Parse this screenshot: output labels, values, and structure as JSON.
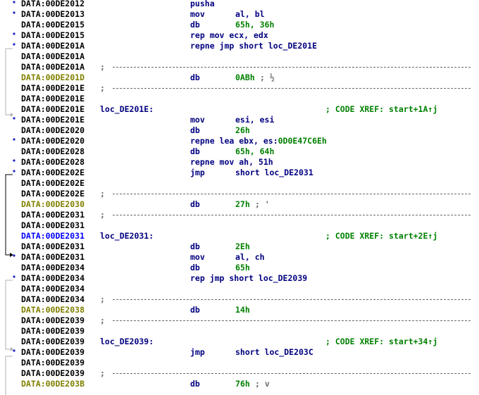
{
  "rows": [
    {
      "addr": "DATA:00DE2012",
      "ac": 0,
      "mn": "pusha",
      "op": "",
      "dot": true
    },
    {
      "addr": "DATA:00DE2013",
      "ac": 0,
      "mn": "mov",
      "op": "al, bl",
      "dot": true
    },
    {
      "addr": "DATA:00DE2015",
      "ac": 0,
      "mn": "db",
      "op": "65h, 36h",
      "opc": "n",
      "dot": false
    },
    {
      "addr": "DATA:00DE2015",
      "ac": 0,
      "mn": "rep mov ecx, edx",
      "op": "",
      "dot": true
    },
    {
      "addr": "DATA:00DE201A",
      "ac": 0,
      "mn": "repne jmp short loc_DE201E",
      "op": "",
      "dot": true
    },
    {
      "addr": "DATA:00DE201A",
      "ac": 0,
      "mn": "",
      "op": "",
      "dot": false
    },
    {
      "addr": "DATA:00DE201A",
      "ac": 0,
      "sep": true,
      "dot": false
    },
    {
      "addr": "DATA:00DE201D",
      "ac": 1,
      "mn": "db",
      "op": "0ABh",
      "opc": "n",
      "cmt": "; ½",
      "cmtc": "gr",
      "dot": false
    },
    {
      "addr": "DATA:00DE201E",
      "ac": 0,
      "sep": true,
      "dot": false
    },
    {
      "addr": "DATA:00DE201E",
      "ac": 0,
      "mn": "",
      "op": "",
      "dot": false
    },
    {
      "addr": "DATA:00DE201E",
      "ac": 0,
      "lbl": "loc_DE201E:",
      "xref": "; CODE XREF: start+1A↑j",
      "dot": false
    },
    {
      "addr": "DATA:00DE201E",
      "ac": 0,
      "mn": "mov",
      "op": "esi, esi",
      "dot": true
    },
    {
      "addr": "DATA:00DE2020",
      "ac": 0,
      "mn": "db",
      "op": "26h",
      "opc": "n",
      "dot": false
    },
    {
      "addr": "DATA:00DE2020",
      "ac": 0,
      "mn": "repne lea ebx, es:",
      "op": "",
      "tail": "0D0E47C6Eh",
      "dot": true
    },
    {
      "addr": "DATA:00DE2028",
      "ac": 0,
      "mn": "db",
      "op": "65h, 64h",
      "opc": "n",
      "dot": false
    },
    {
      "addr": "DATA:00DE2028",
      "ac": 0,
      "mn": "repne mov ah, 51h",
      "op": "",
      "dot": true
    },
    {
      "addr": "DATA:00DE202E",
      "ac": 0,
      "mn": "jmp",
      "op": "short loc_DE2031",
      "dot": true
    },
    {
      "addr": "DATA:00DE202E",
      "ac": 0,
      "mn": "",
      "op": "",
      "dot": false
    },
    {
      "addr": "DATA:00DE202E",
      "ac": 0,
      "sep": true,
      "dot": false
    },
    {
      "addr": "DATA:00DE2030",
      "ac": 1,
      "mn": "db",
      "op": "27h",
      "opc": "n",
      "cmt": "; '",
      "cmtc": "gr",
      "dot": false
    },
    {
      "addr": "DATA:00DE2031",
      "ac": 0,
      "sep": true,
      "dot": false
    },
    {
      "addr": "DATA:00DE2031",
      "ac": 0,
      "mn": "",
      "op": "",
      "dot": false
    },
    {
      "addr": "DATA:00DE2031",
      "ac": 2,
      "lbl": "loc_DE2031:",
      "xref": "; CODE XREF: start+2E↑j",
      "dot": false
    },
    {
      "addr": "DATA:00DE2031",
      "ac": 0,
      "mn": "db",
      "op": "2Eh",
      "opc": "n",
      "dot": false
    },
    {
      "addr": "DATA:00DE2031",
      "ac": 0,
      "mn": "mov",
      "op": "al, ch",
      "dot": true
    },
    {
      "addr": "DATA:00DE2034",
      "ac": 0,
      "mn": "db",
      "op": "65h",
      "opc": "n",
      "dot": false
    },
    {
      "addr": "DATA:00DE2034",
      "ac": 0,
      "mn": "rep jmp short loc_DE2039",
      "op": "",
      "dot": true
    },
    {
      "addr": "DATA:00DE2034",
      "ac": 0,
      "mn": "",
      "op": "",
      "dot": false
    },
    {
      "addr": "DATA:00DE2034",
      "ac": 0,
      "sep": true,
      "dot": false
    },
    {
      "addr": "DATA:00DE2038",
      "ac": 1,
      "mn": "db",
      "op": "14h",
      "opc": "n",
      "dot": false
    },
    {
      "addr": "DATA:00DE2039",
      "ac": 0,
      "sep": true,
      "dot": false
    },
    {
      "addr": "DATA:00DE2039",
      "ac": 0,
      "mn": "",
      "op": "",
      "dot": false
    },
    {
      "addr": "DATA:00DE2039",
      "ac": 0,
      "lbl": "loc_DE2039:",
      "xref": "; CODE XREF: start+34↑j",
      "dot": false
    },
    {
      "addr": "DATA:00DE2039",
      "ac": 0,
      "mn": "jmp",
      "op": "short loc_DE203C",
      "dot": true
    },
    {
      "addr": "DATA:00DE2039",
      "ac": 0,
      "mn": "",
      "op": "",
      "dot": false
    },
    {
      "addr": "DATA:00DE2039",
      "ac": 0,
      "sep": true,
      "dot": false
    },
    {
      "addr": "DATA:00DE203B",
      "ac": 1,
      "mn": "db",
      "op": "76h",
      "opc": "n",
      "cmt": "; v",
      "cmtc": "gr",
      "dot": false
    }
  ]
}
